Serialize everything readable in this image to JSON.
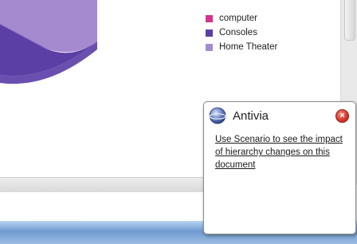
{
  "legend": {
    "items": [
      {
        "label": "computer",
        "color": "#d4348f"
      },
      {
        "label": "Consoles",
        "color": "#5b3fa4"
      },
      {
        "label": "Home Theater",
        "color": "#a58ad0"
      }
    ]
  },
  "popup": {
    "title": "Antivia",
    "message": "Use Scenario to see the impact of hierarchy changes on this document"
  },
  "colors": {
    "pie_light": "#a58ad0",
    "pie_dark": "#5b3fa4",
    "pie_shade": "#7d64bc",
    "taskbar": "#7fa6d6"
  }
}
